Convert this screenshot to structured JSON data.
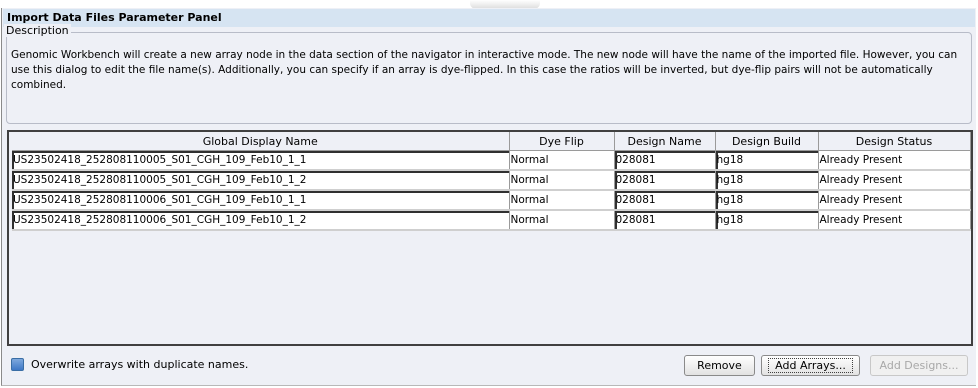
{
  "panel": {
    "title": "Import Data Files Parameter Panel",
    "description_label": "Description",
    "description_text": "Genomic Workbench will create a new array node in the data section of the navigator in interactive mode. The new node will have the name of the imported file. However, you can use this dialog to edit the file name(s). Additionally, you can specify if an array is dye-flipped. In this case the ratios will be inverted, but dye-flip pairs will not be automatically combined."
  },
  "table": {
    "columns": [
      "Global Display Name",
      "Dye Flip",
      "Design Name",
      "Design Build",
      "Design Status"
    ],
    "rows": [
      {
        "name": "US23502418_252808110005_S01_CGH_109_Feb10_1_1",
        "dye_flip": "Normal",
        "design_name": "028081",
        "design_build": "hg18",
        "design_status": "Already Present"
      },
      {
        "name": "US23502418_252808110005_S01_CGH_109_Feb10_1_2",
        "dye_flip": "Normal",
        "design_name": "028081",
        "design_build": "hg18",
        "design_status": "Already Present"
      },
      {
        "name": "US23502418_252808110006_S01_CGH_109_Feb10_1_1",
        "dye_flip": "Normal",
        "design_name": "028081",
        "design_build": "hg18",
        "design_status": "Already Present"
      },
      {
        "name": "US23502418_252808110006_S01_CGH_109_Feb10_1_2",
        "dye_flip": "Normal",
        "design_name": "028081",
        "design_build": "hg18",
        "design_status": "Already Present"
      }
    ]
  },
  "footer": {
    "overwrite_label": "Overwrite arrays with duplicate names.",
    "overwrite_checked": false,
    "remove_label": "Remove",
    "add_arrays_label": "Add Arrays...",
    "add_designs_label": "Add Designs..."
  },
  "colors": {
    "panel_bg": "#eef0f6",
    "title_bg": "#d6e4f2",
    "checkbox_fill": "#3e78c6"
  }
}
